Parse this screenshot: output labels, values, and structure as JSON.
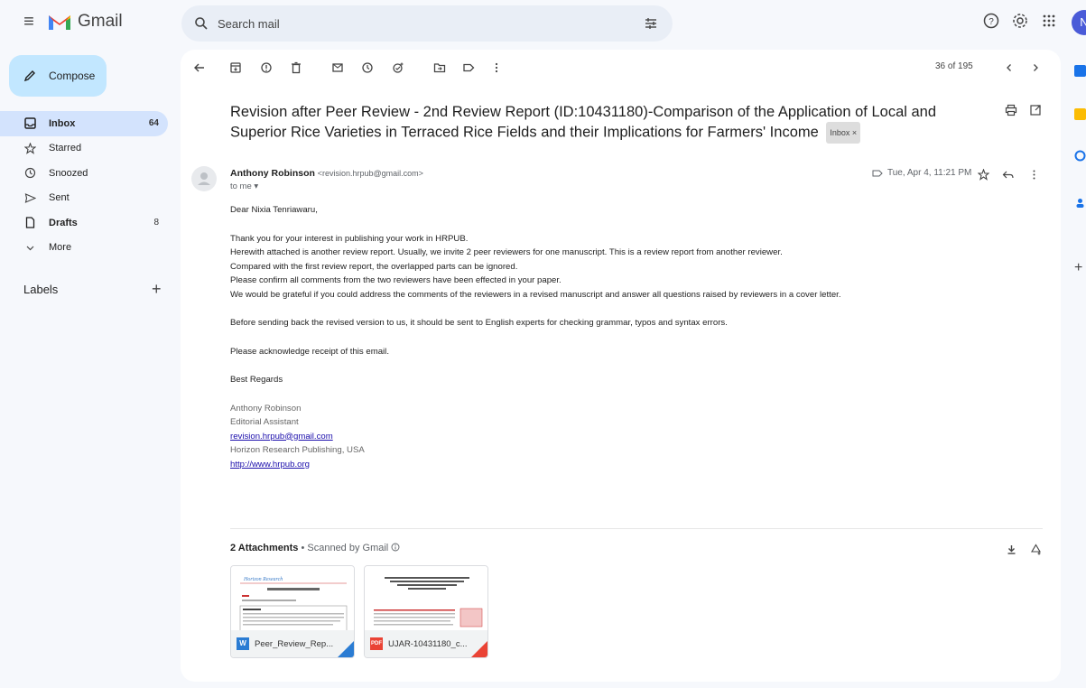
{
  "app": {
    "name": "Gmail"
  },
  "search": {
    "placeholder": "Search mail"
  },
  "user": {
    "avatar_initial": "N"
  },
  "compose": {
    "label": "Compose"
  },
  "nav": {
    "items": [
      {
        "label": "Inbox",
        "count": "64",
        "icon": "inbox-icon"
      },
      {
        "label": "Starred",
        "count": "",
        "icon": "star-icon"
      },
      {
        "label": "Snoozed",
        "count": "",
        "icon": "clock-icon"
      },
      {
        "label": "Sent",
        "count": "",
        "icon": "send-icon"
      },
      {
        "label": "Drafts",
        "count": "8",
        "icon": "draft-icon"
      },
      {
        "label": "More",
        "count": "",
        "icon": "chevron-down-icon"
      }
    ],
    "labels_title": "Labels"
  },
  "toolbar": {
    "pager": "36 of 195"
  },
  "email": {
    "subject": "Revision after Peer Review - 2nd Review Report (ID:10431180)-Comparison of the Application of Local and Superior Rice Varieties in Terraced Rice Fields and their Implications for Farmers' Income",
    "label_chip": "Inbox ×",
    "sender_name": "Anthony Robinson",
    "sender_email": "<revision.hrpub@gmail.com>",
    "to": "to me ▾",
    "datetime": "Tue, Apr 4, 11:21 PM",
    "greeting": "Dear Nixia Tenriawaru,",
    "para1": [
      "Thank you for your interest in publishing your work in HRPUB.",
      "Herewith attached is another review report. Usually, we invite 2 peer reviewers for one manuscript. This is a review report from another reviewer.",
      "Compared with the first review report, the overlapped parts can be ignored.",
      "Please confirm all comments from the two reviewers have been effected in your paper.",
      "We would be grateful if you could address the comments of the reviewers in a revised manuscript and answer all questions raised by reviewers in a cover letter."
    ],
    "para2": "Before sending back the revised version to us, it should be sent to English experts for checking grammar, typos and syntax errors.",
    "para3": "Please acknowledge receipt of this email.",
    "closing": "Best Regards",
    "signature": {
      "name": "Anthony Robinson",
      "title": "Editorial Assistant",
      "email": "revision.hrpub@gmail.com",
      "company": "Horizon Research Publishing, USA",
      "website": "http://www.hrpub.org"
    }
  },
  "attachments": {
    "title": "2 Attachments",
    "scanned": "Scanned by Gmail",
    "files": [
      {
        "name": "Peer_Review_Rep...",
        "type": "W",
        "color": "#2b7cd3"
      },
      {
        "name": "UJAR-10431180_c...",
        "type": "PDF",
        "color": "#ea4335"
      }
    ]
  },
  "colors": {
    "background": "#f6f8fc",
    "compose": "#c2e7ff",
    "active_nav": "#d3e3fd",
    "link": "#1a0dab"
  }
}
